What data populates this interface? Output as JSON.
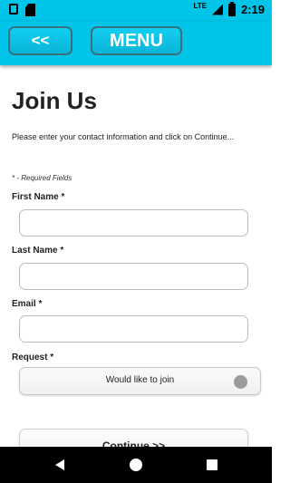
{
  "status_bar": {
    "time": "2:19",
    "network": "LTE",
    "background_color": "#00c4e8",
    "icons": [
      "square-notification-icon",
      "sd-card-icon",
      "lte-icon",
      "signal-icon",
      "battery-icon"
    ]
  },
  "app_bar": {
    "back_label": "<<",
    "menu_label": "MENU",
    "background_color": "#00c4e8"
  },
  "form": {
    "title": "Join Us",
    "intro": "Please enter your contact information and click on Continue...",
    "required_note": "* - Required Fields",
    "fields": {
      "first_name": {
        "label": "First Name *",
        "value": ""
      },
      "last_name": {
        "label": "Last Name *",
        "value": ""
      },
      "email": {
        "label": "Email *",
        "value": ""
      },
      "request": {
        "label": "Request *",
        "selected": "Would like to join"
      }
    },
    "continue_label": "Continue >>"
  },
  "nav_bar": {
    "icons": [
      "back-icon",
      "home-icon",
      "recent-apps-icon"
    ]
  }
}
